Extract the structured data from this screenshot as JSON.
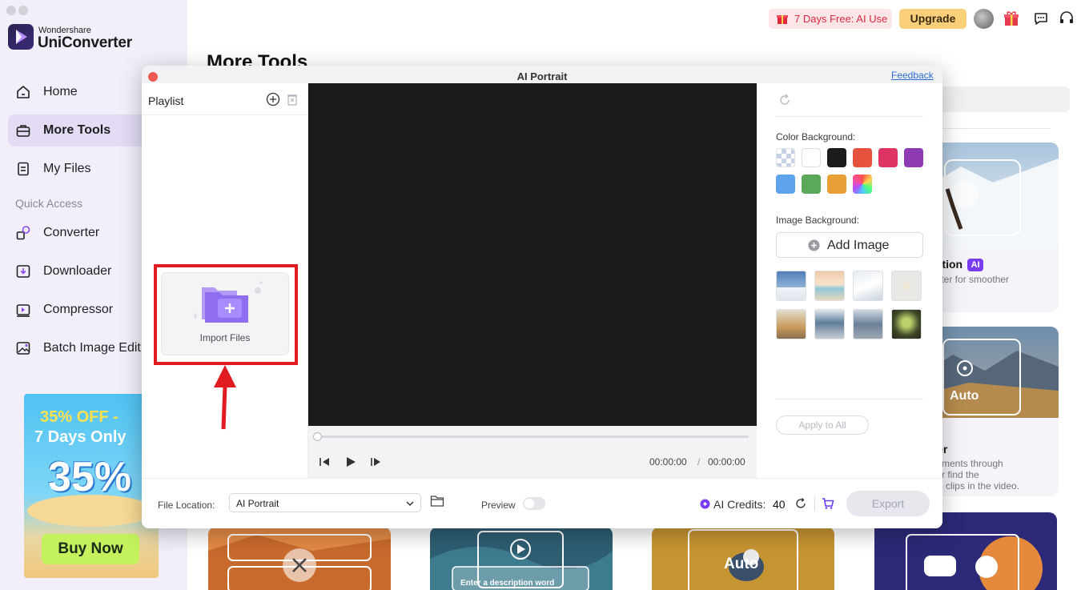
{
  "app": {
    "brand_small": "Wondershare",
    "brand_name": "UniConverter"
  },
  "sidebar": {
    "items": [
      {
        "label": "Home",
        "icon": "home-icon"
      },
      {
        "label": "More Tools",
        "icon": "toolbox-icon",
        "active": true
      },
      {
        "label": "My Files",
        "icon": "file-icon"
      }
    ],
    "section_label": "Quick Access",
    "quick_items": [
      {
        "label": "Converter",
        "icon": "converter-icon"
      },
      {
        "label": "Downloader",
        "icon": "downloader-icon"
      },
      {
        "label": "Compressor",
        "icon": "compressor-icon"
      },
      {
        "label": "Batch Image Edit",
        "icon": "image-edit-icon"
      }
    ],
    "promo": {
      "line1": "35% OFF -",
      "line2": "7 Days Only",
      "big": "35%",
      "button": "Buy Now"
    }
  },
  "topbar": {
    "free_trial": "7 Days Free: AI Use",
    "upgrade": "Upgrade",
    "icons": [
      "gift-icon",
      "chat-icon",
      "headset-icon"
    ]
  },
  "main": {
    "title": "More Tools",
    "cards": [
      {
        "title_fragment": "ilization",
        "badge": "AI",
        "desc_fragment": "eo jitter for smoother"
      },
      {
        "overlay": "Auto",
        "title_fragment": "amer",
        "desc_lines": [
          "t segments through",
          "gs, or find the",
          "son's clips in the video."
        ]
      }
    ],
    "bottom_cards": [
      {
        "overlay": ""
      },
      {
        "overlay": "Enter a description word"
      },
      {
        "overlay": "Auto"
      },
      {
        "overlay": ""
      }
    ]
  },
  "modal": {
    "title": "AI Portrait",
    "feedback": "Feedback",
    "playlist": {
      "label": "Playlist",
      "import_label": "Import Files"
    },
    "player": {
      "progress": 0,
      "current_time": "00:00:00",
      "separator": "/",
      "total_time": "00:00:00"
    },
    "right_panel": {
      "color_label": "Color Background:",
      "colors": [
        "transparent",
        "#ffffff",
        "#1c1c1f",
        "#e5533f",
        "#dc3563",
        "#8e3bb3",
        "#5ea4ec",
        "#5aa95a",
        "#ea9f36",
        "gradient"
      ],
      "image_label": "Image Background:",
      "add_image": "Add Image",
      "thumbnail_count": 8,
      "apply_all": "Apply to All"
    },
    "footer": {
      "file_location_label": "File Location:",
      "file_location_value": "AI Portrait",
      "preview_label": "Preview",
      "preview_on": false,
      "credits_label": "AI Credits:",
      "credits_value": "40",
      "export": "Export"
    }
  }
}
